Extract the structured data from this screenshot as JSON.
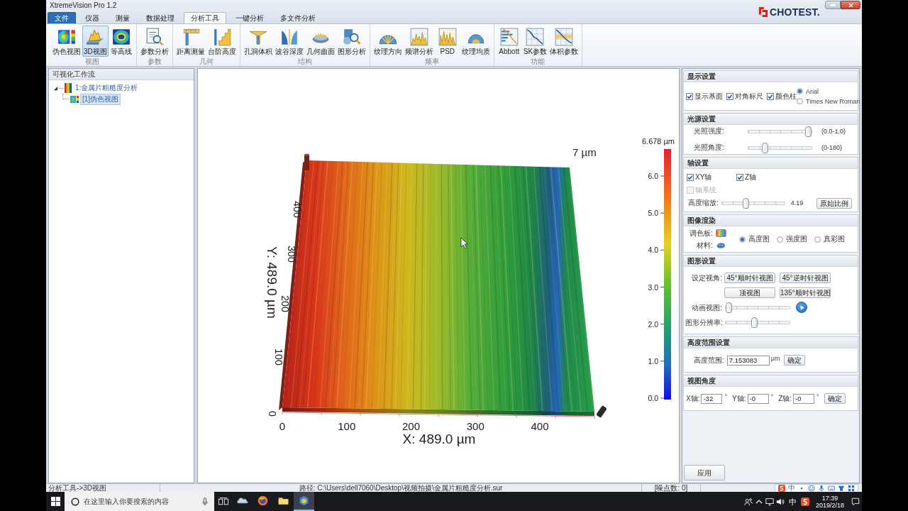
{
  "window": {
    "title": "XtremeVision Pro 1.2",
    "logo": "CHOTEST."
  },
  "menu_tabs": [
    {
      "label": "文件",
      "kind": "file",
      "selected": false
    },
    {
      "label": "仪器",
      "kind": "tab",
      "selected": false
    },
    {
      "label": "测量",
      "kind": "tab",
      "selected": false
    },
    {
      "label": "数据处理",
      "kind": "tab",
      "selected": false
    },
    {
      "label": "分析工具",
      "kind": "tab",
      "selected": true
    },
    {
      "label": "一键分析",
      "kind": "tab",
      "selected": false
    },
    {
      "label": "多文件分析",
      "kind": "tab",
      "selected": false
    }
  ],
  "ribbon": {
    "groups": [
      {
        "label": "视图",
        "buttons": [
          {
            "label": "伪色视图",
            "selected": false
          },
          {
            "label": "3D视图",
            "selected": true
          },
          {
            "label": "等高线",
            "selected": false
          }
        ]
      },
      {
        "label": "参数",
        "buttons": [
          {
            "label": "参数分析",
            "selected": false
          }
        ]
      },
      {
        "label": "几何",
        "buttons": [
          {
            "label": "距离测量",
            "selected": false
          },
          {
            "label": "台阶高度",
            "selected": false
          }
        ]
      },
      {
        "label": "结构",
        "buttons": [
          {
            "label": "孔洞体积",
            "selected": false
          },
          {
            "label": "波谷深度",
            "selected": false
          },
          {
            "label": "几何曲面",
            "selected": false
          },
          {
            "label": "图形分析",
            "selected": false
          }
        ]
      },
      {
        "label": "频率",
        "buttons": [
          {
            "label": "纹理方向",
            "selected": false
          },
          {
            "label": "频谱分析",
            "selected": false
          },
          {
            "label": "PSD",
            "selected": false
          },
          {
            "label": "纹理均质",
            "selected": false
          }
        ]
      },
      {
        "label": "功能",
        "buttons": [
          {
            "label": "Abbott",
            "selected": false
          },
          {
            "label": "SK参数",
            "selected": false
          },
          {
            "label": "体积参数",
            "selected": false
          }
        ]
      }
    ]
  },
  "workflow": {
    "title": "可视化工作流",
    "tree": [
      {
        "label": "1:金属片粗糙度分析",
        "expanded": true,
        "selected": false,
        "children": [
          {
            "label": "[1]伪色视图",
            "selected": true
          }
        ]
      }
    ]
  },
  "view": {
    "z_label": "7 µm",
    "x_axis": {
      "label": "X: 489.0 µm",
      "ticks": [
        "0",
        "100",
        "200",
        "300",
        "400"
      ]
    },
    "y_axis": {
      "label": "Y: 489.0 µm",
      "ticks": [
        "0",
        "100",
        "200",
        "300",
        "400"
      ]
    },
    "color_bar": {
      "title": "6.678 µm",
      "ticks": [
        "6.0",
        "5.0",
        "4.0",
        "3.0",
        "2.0",
        "1.0",
        "0.0"
      ]
    }
  },
  "settings": {
    "display": {
      "title": "显示设置",
      "checkboxes": [
        {
          "label": "显示基面",
          "checked": true
        },
        {
          "label": "对角标尺",
          "checked": true
        },
        {
          "label": "颜色柱",
          "checked": true
        }
      ],
      "fonts": [
        {
          "label": "Arial",
          "selected": true
        },
        {
          "label": "Times New Roman",
          "selected": false
        }
      ]
    },
    "light": {
      "title": "光源设置",
      "sliders": [
        {
          "label": "光照强度:",
          "level": 1.0,
          "reading": "(0.0-1.0)"
        },
        {
          "label": "光照角度:",
          "level": 0.24,
          "reading": "(0-180)"
        }
      ]
    },
    "axes": {
      "title": "轴设置",
      "checkboxes": [
        {
          "label": "XY轴",
          "checked": true,
          "disabled": false
        },
        {
          "label": "Z轴",
          "checked": true,
          "disabled": false
        },
        {
          "label": "轴系统",
          "checked": false,
          "disabled": true
        }
      ],
      "scale": {
        "label": "高度缩放:",
        "level": 0.37,
        "reading": "4.19"
      },
      "reset_button": "原始比例"
    },
    "render": {
      "title": "图像渲染",
      "palette_label": "调色板:",
      "material_label": "材料:",
      "modes": [
        {
          "label": "高度图",
          "selected": true
        },
        {
          "label": "强度图",
          "selected": false
        },
        {
          "label": "真彩图",
          "selected": false
        }
      ]
    },
    "graphics": {
      "title": "图形设置",
      "view_label": "设定视角:",
      "view_buttons": [
        "45°顺时针视图",
        "45°逆时针视图",
        "顶视图",
        "135°顺时针视图"
      ],
      "animation": {
        "label": "动画视图:",
        "level": 0
      },
      "resolution": {
        "label": "图形分辨率:",
        "level": 0.45
      }
    },
    "height_range": {
      "title": "高度范围设置",
      "label": "高度范围:",
      "value": "7.153083",
      "unit": "µm",
      "button": "确定"
    },
    "view_angle": {
      "title": "视图角度",
      "fields": [
        {
          "label": "X轴:",
          "value": "-32",
          "unit": "°"
        },
        {
          "label": "Y轴:",
          "value": "-0",
          "unit": "°"
        },
        {
          "label": "Z轴:",
          "value": "-0",
          "unit": "°"
        }
      ],
      "button": "确定"
    },
    "apply_button": "应用"
  },
  "status_bar": {
    "mode": "分析工具->3D视图",
    "path": "路径: C:\\Users\\dell7060\\Desktop\\视频拍摄\\金属片粗糙度分析.sur",
    "points": "[噪点数: 0]",
    "ime": "中"
  },
  "taskbar": {
    "search_placeholder": "在这里输入你要搜索的内容",
    "apps": [
      {
        "selected": false
      },
      {
        "selected": false
      },
      {
        "selected": false
      },
      {
        "selected": true
      }
    ],
    "ime": "中",
    "time": "17:39",
    "date": "2019/2/18"
  }
}
